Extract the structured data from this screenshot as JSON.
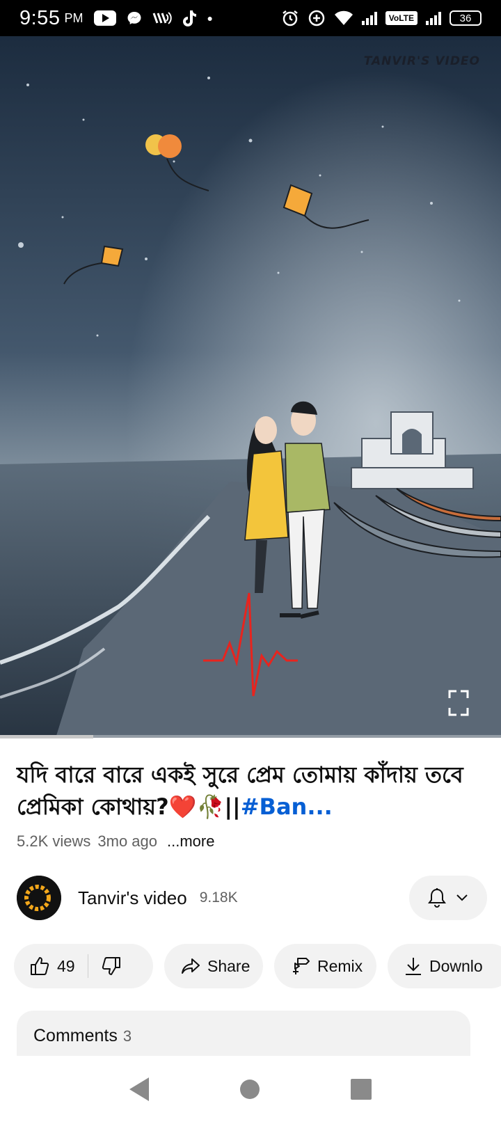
{
  "status_bar": {
    "time": "9:55",
    "time_suffix": "PM",
    "volte": "VoLTE",
    "battery": "36",
    "icons_left": [
      "youtube-icon",
      "messenger-icon",
      "wifi-calling-icon",
      "tiktok-icon",
      "dot-icon"
    ],
    "icons_right": [
      "alarm-icon",
      "data-saver-icon",
      "wifi-icon",
      "signal-icon",
      "battery-icon"
    ]
  },
  "video": {
    "watermark": "TANVIR'S VIDEO",
    "progress_fraction": 0.18
  },
  "title": {
    "text": "যদি বারে বারে একই সুরে প্রেম তোমায় কাঁদায় তবে প্রেমিকা কোথায়?❤️🥀||",
    "hashtag": "#Ban..."
  },
  "meta": {
    "views": "5.2K views",
    "age": "3mo ago",
    "more": "...more"
  },
  "channel": {
    "name": "Tanvir's video",
    "subscribers": "9.18K",
    "avatar_text": "TANVIR'S VIDEO"
  },
  "actions": {
    "like_count": "49",
    "share": "Share",
    "remix": "Remix",
    "download": "Downlo"
  },
  "comments": {
    "label": "Comments",
    "count": "3"
  },
  "colors": {
    "accent": "#ff0000",
    "hashtag": "#065fd4",
    "pill_bg": "#f2f2f2"
  }
}
